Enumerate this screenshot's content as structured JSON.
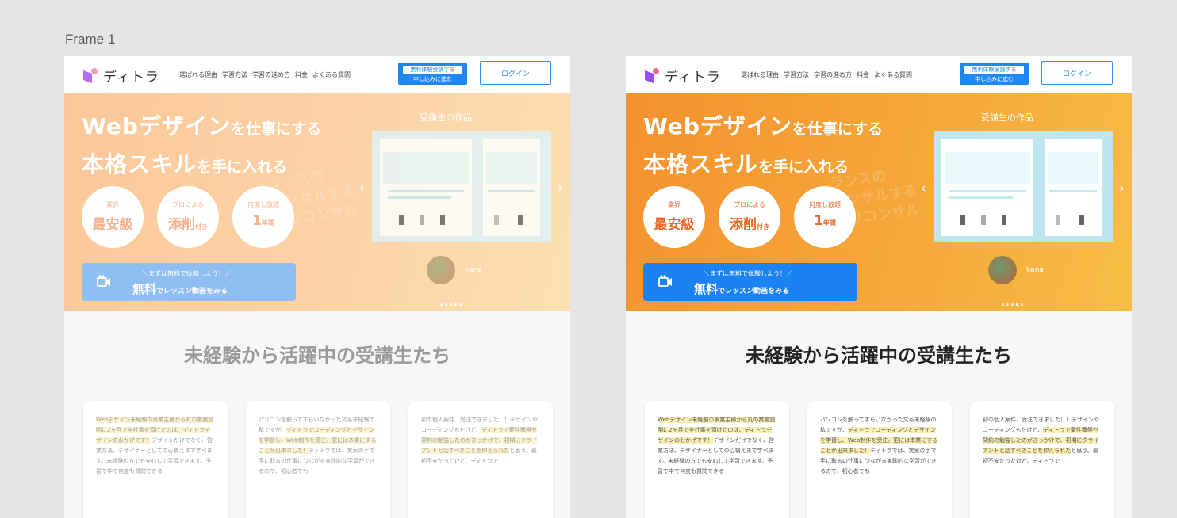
{
  "frame_label": "Frame 1",
  "header": {
    "logo": "ディトラ",
    "nav": [
      "選ばれる理由",
      "学習方法",
      "学習の進め方",
      "料金",
      "よくある質問"
    ],
    "apply_top": "無料体験受講する",
    "apply_bottom": "申し込みに進む",
    "login": "ログイン"
  },
  "hero": {
    "headline1_big": "Webデザイン",
    "headline1_small": "を仕事にする",
    "headline2_big": "本格スキル",
    "headline2_small": "を手に入れる",
    "badges": [
      {
        "top": "業界",
        "bottom": "最安級",
        "suffix": ""
      },
      {
        "top": "プロによる",
        "bottom": "添削",
        "suffix": "付き"
      },
      {
        "top": "何度し放題",
        "bottom": "1",
        "suffix": "年間"
      }
    ],
    "cta_line1": "＼まずは無料で体験しよう！／",
    "cta_line2_big": "無料",
    "cta_line2_small": "でレッスン動画をみる",
    "works_title": "受講生の作品",
    "student_name": "kana",
    "ghost_text": "ランスの\nコンサルする\nフリコンサル"
  },
  "section": {
    "title": "未経験から活躍中の受講生たち"
  },
  "testimonials": [
    {
      "highlight": "Webデザイン未経験の事業主様から丸の業務説明に2ヶ月で全社事を頂けたのは、ディトラデザインのおかげです！",
      "rest": "デザインだけでなく、営業方法、デザイナーとしての心構えまで学べます。未経験の方でも安心して学習できます。予習で中で何度も質問できる"
    },
    {
      "plain": "パソコンを触ってすらいなかった文系未経験の私ですが、",
      "highlight": "ディトラでコーディングとデザインを学習し、Web制作を受注。更には本業にすることが出来ました！",
      "rest": "ディトラでは、実案の手で手に取るの仕事につながる実践的な学習ができるので、初心者でも"
    },
    {
      "plain": "初の個人案件、受注できました！！デザインやコーディングもだけど、",
      "highlight": "ディトラで案件獲得や契約の勉強したのがきっかけで、初期にクライアントと話すべきことを抑えられた",
      "rest": "と思う。最初不安だったけど、ディトラで"
    }
  ]
}
